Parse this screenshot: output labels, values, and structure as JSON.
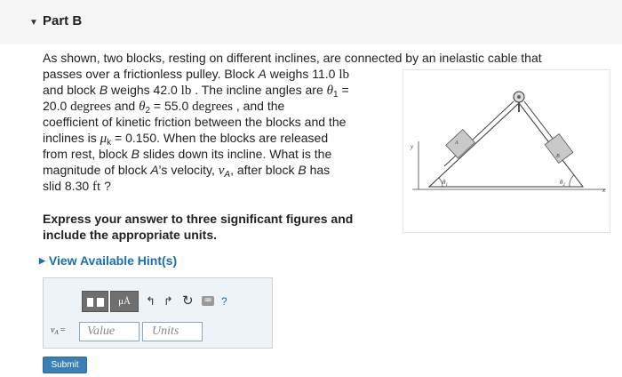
{
  "part": {
    "title": "Part B"
  },
  "problem": {
    "l1": "As shown, two blocks, resting on different inclines, are connected by an inelastic cable that",
    "l2a": "passes over a frictionless pulley. Block ",
    "l2b": "A",
    "l2c": " weighs 11.0 ",
    "l2d": "lb",
    "l3a": "and block ",
    "l3b": "B",
    "l3c": " weighs 42.0 ",
    "l3d": "lb",
    "l3e": " . The incline angles are ",
    "l3f": "θ",
    "l3g": "1",
    "l3h": " =",
    "l4a": "20.0 ",
    "l4b": "degrees",
    "l4c": " and ",
    "l4d": "θ",
    "l4e": "2",
    "l4f": " = 55.0 ",
    "l4g": "degrees",
    "l4h": " , and the",
    "l5": "coefficient of kinetic friction between the blocks and the",
    "l6a": "inclines is ",
    "l6b": "μ",
    "l6c": "k",
    "l6d": " = 0.150. When the blocks are released",
    "l7a": "from rest, block ",
    "l7b": "B",
    "l7c": " slides down its incline. What is the",
    "l8a": "magnitude of block ",
    "l8b": "A",
    "l8c": "'s velocity, ",
    "l8d": "v",
    "l8e": "A",
    "l8f": ", after block ",
    "l8g": "B",
    "l8h": " has",
    "l9a": "slid 8.30 ",
    "l9b": "ft",
    "l9c": " ?"
  },
  "figure": {
    "block_a": "A",
    "block_b": "B",
    "theta1": "θ",
    "theta1_sub": "1",
    "theta2": "θ",
    "theta2_sub": "2",
    "y_axis": "y",
    "x_axis": "x"
  },
  "instruction": {
    "line1": "Express your answer to three significant figures and",
    "line2": "include the appropriate units."
  },
  "hint": {
    "label": "View Available Hint(s)"
  },
  "toolbar": {
    "mu_label": "μÅ",
    "undo": "↰",
    "redo": "↱",
    "reset": "↻",
    "keyboard": "⌨",
    "help": "?"
  },
  "answer": {
    "label_var": "v",
    "label_sub": "A",
    "label_eq": "=",
    "value_placeholder": "Value",
    "units_placeholder": "Units"
  },
  "submit": {
    "label": "Submit"
  }
}
